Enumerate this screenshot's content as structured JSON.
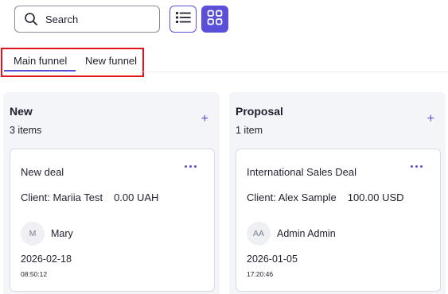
{
  "search": {
    "label": "Search",
    "icon": "search-icon"
  },
  "view_toggle": {
    "list_icon": "list-icon",
    "grid_icon": "grid-icon",
    "active": "grid",
    "accent": "#5b4fd9"
  },
  "tabs": [
    {
      "label": "Main funnel",
      "active": true
    },
    {
      "label": "New funnel",
      "active": false
    }
  ],
  "columns": [
    {
      "title": "New",
      "count": "3 items",
      "add": "+",
      "card": {
        "title": "New deal",
        "client": "Client: Mariia Test",
        "amount": "0.00 UAH",
        "avatar": "M",
        "owner": "Mary",
        "date": "2026-02-18",
        "time": "08:50:12"
      }
    },
    {
      "title": "Proposal",
      "count": "1 item",
      "add": "+",
      "card": {
        "title": "International Sales Deal",
        "client": "Client: Alex Sample",
        "amount": "100.00 USD",
        "avatar": "AA",
        "owner": "Admin Admin",
        "date": "2026-01-05",
        "time": "17:20:46"
      }
    }
  ],
  "colors": {
    "accent": "#5b4fd9",
    "highlight": "#e0141b",
    "column_bg": "#f4f5f8"
  }
}
